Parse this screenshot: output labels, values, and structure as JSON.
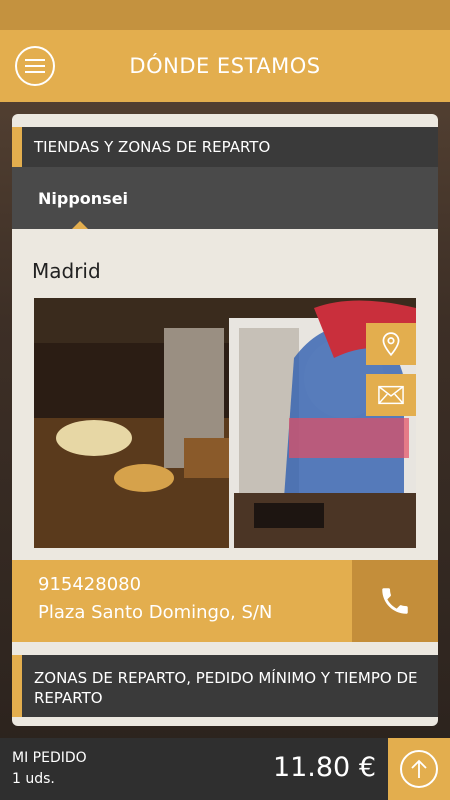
{
  "app": {
    "title": "DÓNDE ESTAMOS",
    "accent": "#e3ae4e",
    "dark_accent": "#c48e3a",
    "dark_bg": "#3a3a3a"
  },
  "menu_icon": "hamburger-menu-icon",
  "stores_section": {
    "header": "TIENDAS Y ZONAS DE REPARTO",
    "tabs": [
      "Nipponsei"
    ],
    "selected_tab": "Nipponsei"
  },
  "store": {
    "city": "Madrid",
    "phone": "915428080",
    "address": "Plaza Santo Domingo, S/N",
    "actions": {
      "map_icon": "location-pin-icon",
      "mail_icon": "envelope-icon",
      "call_icon": "phone-icon"
    }
  },
  "delivery_section": {
    "header": "ZONAS DE REPARTO, PEDIDO MÍNIMO Y TIEMPO DE REPARTO"
  },
  "footer": {
    "label": "MI PEDIDO",
    "units": "1 uds.",
    "total": "11.80 €",
    "up_icon": "arrow-up-icon"
  }
}
